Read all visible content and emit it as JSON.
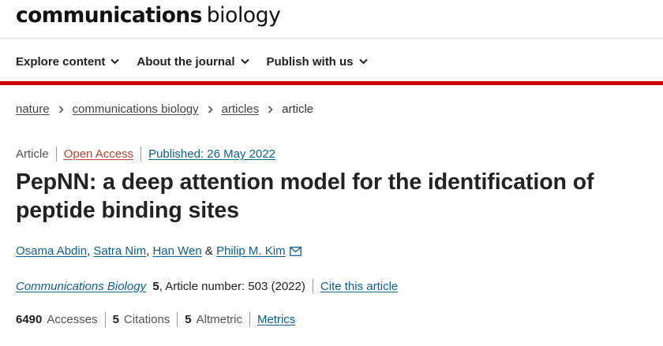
{
  "masthead": {
    "brand_bold": "communications",
    "brand_light": "biology"
  },
  "nav": {
    "items": [
      {
        "label": "Explore content"
      },
      {
        "label": "About the journal"
      },
      {
        "label": "Publish with us"
      }
    ]
  },
  "breadcrumb": {
    "items": [
      "nature",
      "communications biology",
      "articles"
    ],
    "current": "article"
  },
  "meta": {
    "type": "Article",
    "access": "Open Access",
    "published": "Published: 26 May 2022"
  },
  "article": {
    "title": "PepNN: a deep attention model for the identification of peptide binding sites",
    "authors": [
      "Osama Abdin",
      "Satra Nim",
      "Han Wen",
      "Philip M. Kim"
    ],
    "author_sep": ",",
    "author_and": "&"
  },
  "citation": {
    "journal": "Communications Biology",
    "volume": "5",
    "article_number": ", Article number: 503 (2022)",
    "cite_label": "Cite this article"
  },
  "metrics": {
    "accesses_value": "6490",
    "accesses_label": "Accesses",
    "citations_value": "5",
    "citations_label": "Citations",
    "altmetric_value": "5",
    "altmetric_label": "Altmetric",
    "link_label": "Metrics"
  },
  "colors": {
    "accent_red": "#cc0000",
    "link_blue": "#0d5f93",
    "open_access": "#b3452e"
  }
}
